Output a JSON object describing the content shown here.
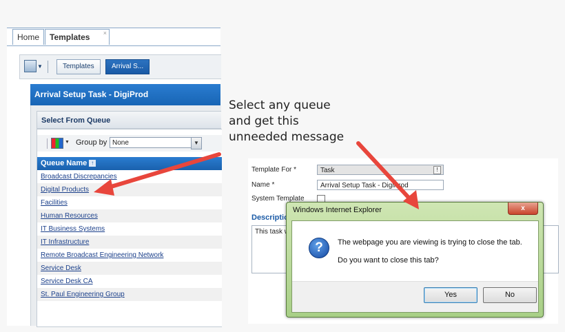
{
  "tabs": {
    "home": "Home",
    "templates": "Templates",
    "close_glyph": "×"
  },
  "toolbar": {
    "templates_btn": "Templates",
    "arrival_btn": "Arrival S..."
  },
  "task_header": "Arrival Setup Task - DigiProd",
  "queue": {
    "title": "Select From Queue",
    "group_by_label": "Group by",
    "group_by_value": "None",
    "column_header": "Queue Name",
    "rows": [
      "Broadcast Discrepancies",
      "Digital Products",
      "Facilities",
      "Human Resources",
      "IT Business Systems",
      "IT Infrastructure",
      "Remote Broadcast Engineering Network",
      "Service Desk",
      "Service Desk CA",
      "St. Paul Engineering Group"
    ]
  },
  "annotation": {
    "line1": "Select any queue",
    "line2": "and get this",
    "line3": "unneeded message"
  },
  "form": {
    "template_for_label": "Template For *",
    "template_for_value": "Task",
    "name_label": "Name *",
    "name_value": "Arrival Setup Task - DigiProd",
    "system_template_label": "System Template",
    "description_label": "Description",
    "description_value": "This task w"
  },
  "dialog": {
    "title": "Windows Internet Explorer",
    "close_glyph": "x",
    "message1": "The webpage you are viewing is trying to close the tab.",
    "message2": "Do you want to close this tab?",
    "yes": "Yes",
    "no": "No"
  },
  "colors": {
    "accent": "#1a65b5",
    "arrow": "#e8463c",
    "dialog_frame": "#a8cf86"
  }
}
